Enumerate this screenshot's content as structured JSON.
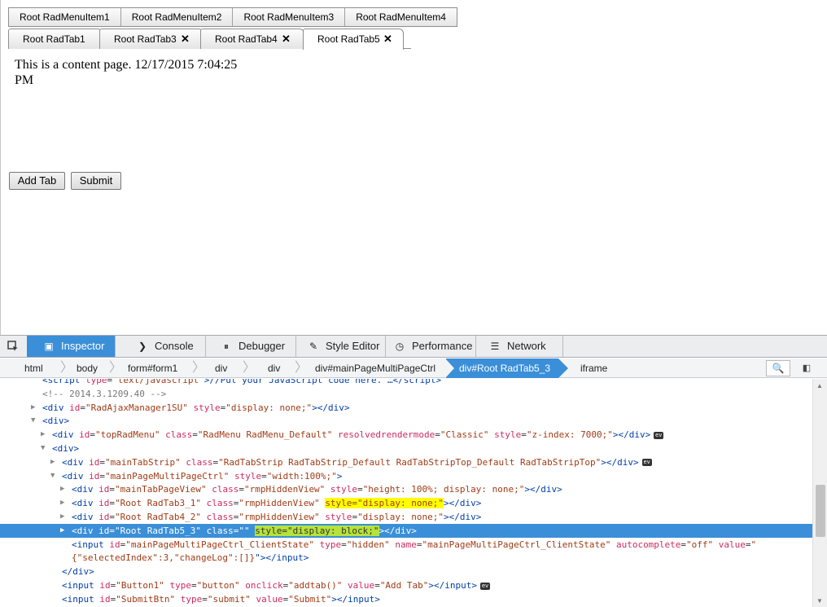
{
  "menu": {
    "items": [
      "Root RadMenuItem1",
      "Root RadMenuItem2",
      "Root RadMenuItem3",
      "Root RadMenuItem4"
    ]
  },
  "tabs": {
    "items": [
      {
        "label": "Root RadTab1",
        "closable": false,
        "selected": false
      },
      {
        "label": "Root RadTab3",
        "closable": true,
        "selected": false
      },
      {
        "label": "Root RadTab4",
        "closable": true,
        "selected": false
      },
      {
        "label": "Root RadTab5",
        "closable": true,
        "selected": true
      }
    ],
    "close_glyph": "✕"
  },
  "content": {
    "text": "This is a content page. 12/17/2015 7:04:25 PM"
  },
  "buttons": {
    "add_tab": "Add Tab",
    "submit": "Submit"
  },
  "devtools": {
    "tabs": [
      {
        "label": "Inspector",
        "icon": "inspector-icon",
        "selected": true
      },
      {
        "label": "Console",
        "icon": "console-icon",
        "selected": false
      },
      {
        "label": "Debugger",
        "icon": "debugger-icon",
        "selected": false
      },
      {
        "label": "Style Editor",
        "icon": "style-editor-icon",
        "selected": false
      },
      {
        "label": "Performance",
        "icon": "performance-icon",
        "selected": false
      },
      {
        "label": "Network",
        "icon": "network-icon",
        "selected": false
      }
    ],
    "breadcrumbs": [
      "html",
      "body",
      "form#form1",
      "div",
      "div",
      "div#mainPageMultiPageCtrl",
      "div#Root RadTab5_3",
      "iframe"
    ],
    "selected_crumb": "div#Root RadTab5_3",
    "colors": {
      "accent": "#3a8fd8",
      "highlight": "#ffff00",
      "selected_highlight": "#b6e23a"
    },
    "code_lines": [
      "<script type=\"text/javascript\">//Put your JavaScript code here. …</script>",
      "<!-- 2014.3.1209.40 -->",
      "<div id=\"RadAjaxManager1SU\" style=\"display: none;\"></div>",
      "<div>",
      "<div id=\"topRadMenu\" class=\"RadMenu RadMenu_Default\" resolvedrendermode=\"Classic\" style=\"z-index: 7000;\"></div>",
      "<div>",
      "<div id=\"mainTabStrip\" class=\"RadTabStrip RadTabStrip_Default RadTabStripTop_Default RadTabStripTop\"></div>",
      "<div id=\"mainPageMultiPageCtrl\" style=\"width:100%;\">",
      "<div id=\"mainTabPageView\" class=\"rmpHiddenView\" style=\"height: 100%; display: none;\"></div>",
      "<div id=\"Root RadTab3_1\" class=\"rmpHiddenView\" style=\"display: none;\"></div>",
      "<div id=\"Root RadTab4_2\" class=\"rmpHiddenView\" style=\"display: none;\"></div>",
      "<div id=\"Root RadTab5_3\" class=\"\" style=\"display: block;\"></div>",
      "<input id=\"mainPageMultiPageCtrl_ClientState\" type=\"hidden\" name=\"mainPageMultiPageCtrl_ClientState\" autocomplete=\"off\" value=\"",
      "{\"selectedIndex\":3,\"changeLog\":[]}\"></input>",
      "</div>",
      "<input id=\"Button1\" type=\"button\" onclick=\"addtab()\" value=\"Add Tab\"></input>",
      "<input id=\"SubmitBtn\" type=\"submit\" value=\"Submit\"></input>"
    ],
    "event_badge": "ev"
  }
}
